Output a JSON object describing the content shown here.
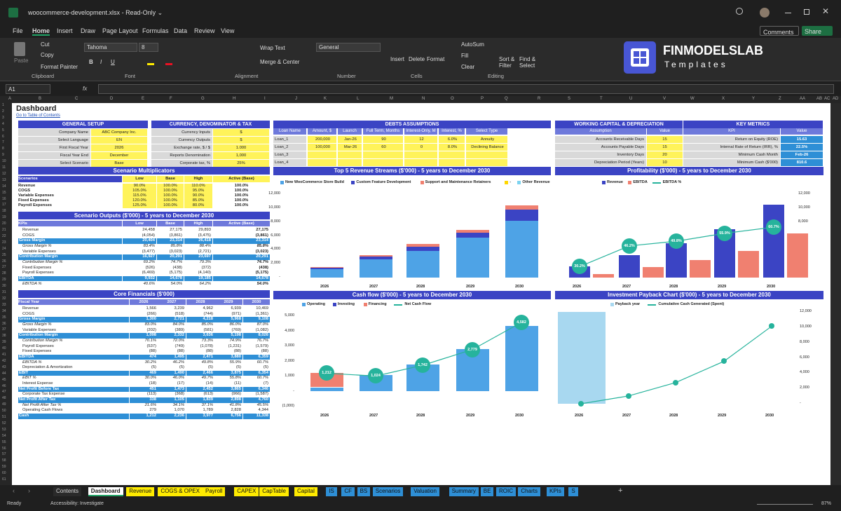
{
  "window": {
    "file": "woocommerce-development.xlsx",
    "mode": "Read-Only",
    "comments": "Comments",
    "share": "Share"
  },
  "menu": [
    "File",
    "Home",
    "Insert",
    "Draw",
    "Page Layout",
    "Formulas",
    "Data",
    "Review",
    "View"
  ],
  "ribbon": {
    "paste": "Paste",
    "cut": "Cut",
    "copy": "Copy",
    "format_painter": "Format Painter",
    "clipboard": "Clipboard",
    "font_name": "Tahoma",
    "font_size": "8",
    "font": "Font",
    "wrap": "Wrap Text",
    "merge": "Merge & Center",
    "alignment": "Alignment",
    "number_format": "General",
    "number": "Number",
    "insert": "Insert",
    "delete": "Delete",
    "format": "Format",
    "cells": "Cells",
    "autosum": "AutoSum",
    "fill": "Fill",
    "clear": "Clear",
    "sort": "Sort &",
    "filter": "Filter",
    "find": "Find &",
    "select": "Select",
    "editing": "Editing",
    "brand": "FINMODELSLAB",
    "brand2": "Templates"
  },
  "formula": {
    "cell": "A1",
    "fx": "fx"
  },
  "columns": [
    "A",
    "B",
    "C",
    "D",
    "E",
    "F",
    "G",
    "H",
    "I",
    "J",
    "K",
    "L",
    "M",
    "N",
    "O",
    "P",
    "Q",
    "R",
    "S",
    "T",
    "U",
    "V",
    "W",
    "X",
    "Y",
    "Z",
    "AA",
    "AB",
    "AC",
    "AD"
  ],
  "sheet": {
    "title": "Dashboard",
    "toc": "Go to Table of Contents",
    "general": {
      "header": "GENERAL SETUP",
      "rows": [
        [
          "Company Name",
          "ABC Company Inc."
        ],
        [
          "Select Language",
          "EN"
        ],
        [
          "First Fiscal Year",
          "2026"
        ],
        [
          "Fiscal Year End",
          "December"
        ],
        [
          "Select Scenario",
          "Base"
        ]
      ]
    },
    "currency": {
      "header": "CURRENCY, DENOMINATOR & TAX",
      "rows": [
        [
          "Currency Inputs",
          "$"
        ],
        [
          "Currency Outputs",
          "$"
        ],
        [
          "Exchange rate, $ / $",
          "1.000"
        ],
        [
          "Reports Denomination",
          "1,000"
        ],
        [
          "Corporate tax, %",
          "25%"
        ]
      ]
    },
    "debts": {
      "header": "DEBTS ASSUMPTIONS",
      "cols": [
        "Loan Name",
        "Amount, $",
        "Launch",
        "Full Term, Months",
        "Interest-Only, M",
        "Interest, %",
        "Select Type"
      ],
      "rows": [
        [
          "Loan_1",
          "200,000",
          "Jan-26",
          "90",
          "12",
          "6.0%",
          "Annuity"
        ],
        [
          "Loan_2",
          "100,000",
          "Mar-26",
          "60",
          "0",
          "8.0%",
          "Declining Balance"
        ],
        [
          "Loan_3",
          "",
          "",
          "",
          "",
          "",
          ""
        ],
        [
          "Loan_4",
          "",
          "",
          "",
          "",
          "",
          ""
        ]
      ]
    },
    "wc": {
      "header": "WORKING CAPITAL & DEPRECIATION",
      "cols": [
        "Assumption",
        "Value"
      ],
      "rows": [
        [
          "Accounts Receivable Days",
          "15"
        ],
        [
          "Accounts Payable Days",
          "15"
        ],
        [
          "Inventory Days",
          "20"
        ],
        [
          "Depreciation Period (Years)",
          "10"
        ]
      ]
    },
    "kpi": {
      "header": "KEY METRICS",
      "cols": [
        "KPI",
        "Value"
      ],
      "rows": [
        [
          "Return on Equity (ROE)",
          "15.63"
        ],
        [
          "Internal Rate of Return (IRR), %",
          "22.5%"
        ],
        [
          "Minimum Cash Month",
          "Feb-26"
        ],
        [
          "Minimum Cash ($'000)",
          "810.6"
        ]
      ]
    },
    "multipliers": {
      "header": "Scenario Multiplicators",
      "cols": [
        "Scenarios",
        "Low",
        "Base",
        "High",
        "Active (Base)"
      ],
      "rows": [
        [
          "Revenue",
          "90.0%",
          "100.0%",
          "110.0%",
          "100.0%"
        ],
        [
          "COGS",
          "105.0%",
          "100.0%",
          "95.0%",
          "100.0%"
        ],
        [
          "Variable Expenses",
          "115.0%",
          "100.0%",
          "90.0%",
          "100.0%"
        ],
        [
          "Fixed Expenses",
          "120.0%",
          "100.0%",
          "85.0%",
          "100.0%"
        ],
        [
          "Payroll Expenses",
          "125.0%",
          "100.0%",
          "80.0%",
          "100.0%"
        ]
      ]
    },
    "outputs": {
      "header": "Scenario Outputs ($'000) - 5 years to December 2030",
      "cols": [
        "KPIs",
        "Low",
        "Base",
        "High",
        "Active (Base)"
      ],
      "rows": [
        [
          "Revenue",
          "24,458",
          "27,175",
          "29,893",
          "27,175",
          "n"
        ],
        [
          "COGS",
          "(4,054)",
          "(3,861)",
          "(3,475)",
          "(3,861)",
          "n"
        ],
        [
          "Gross Margin",
          "20,404",
          "23,314",
          "26,418",
          "23,314",
          "h"
        ],
        [
          "Gross Margin %",
          "83.4%",
          "85.8%",
          "88.4%",
          "85.8%",
          "i"
        ],
        [
          "Variable Expenses",
          "(3,477)",
          "(3,023)",
          "(2,721)",
          "(3,023)",
          "n"
        ],
        [
          "Contribution Margin",
          "16,927",
          "20,291",
          "23,697",
          "20,291",
          "h"
        ],
        [
          "Contribution Margin %",
          "69.2%",
          "74.7%",
          "79.3%",
          "74.7%",
          "i"
        ],
        [
          "Fixed Expenses",
          "(526)",
          "(438)",
          "(372)",
          "(438)",
          "n"
        ],
        [
          "Payroll Expenses",
          "(6,469)",
          "(5,175)",
          "(4,140)",
          "(5,175)",
          "n"
        ],
        [
          "EBITDA",
          "9,932",
          "14,678",
          "19,185",
          "14,678",
          "h"
        ],
        [
          "EBITDA %",
          "40.6%",
          "54.0%",
          "64.2%",
          "54.0%",
          "i"
        ]
      ]
    },
    "core": {
      "header": "Core Financials ($'000)",
      "cols": [
        "Fiscal Year",
        "2026",
        "2027",
        "2028",
        "2029",
        "2030"
      ],
      "rows": [
        [
          "Revenue",
          "1,566",
          "3,239",
          "4,962",
          "6,939",
          "10,469",
          "n"
        ],
        [
          "COGS",
          "(266)",
          "(518)",
          "(744)",
          "(971)",
          "(1,361)",
          "n"
        ],
        [
          "Gross Margin",
          "1,300",
          "2,721",
          "4,218",
          "5,968",
          "9,108",
          "h"
        ],
        [
          "Gross Margin %",
          "83.0%",
          "84.0%",
          "85.0%",
          "86.0%",
          "87.0%",
          "i"
        ],
        [
          "Variable Expenses",
          "(202)",
          "(389)",
          "(581)",
          "(769)",
          "(1,082)",
          "n"
        ],
        [
          "Contribution Margin",
          "1,098",
          "2,332",
          "3,636",
          "5,198",
          "8,026",
          "h"
        ],
        [
          "Contribution Margin %",
          "70.1%",
          "72.0%",
          "73.3%",
          "74.9%",
          "76.7%",
          "i"
        ],
        [
          "Payroll Expenses",
          "(537)",
          "(749)",
          "(1,078)",
          "(1,231)",
          "(1,579)",
          "n"
        ],
        [
          "Fixed Expenses",
          "(88)",
          "(88)",
          "(88)",
          "(88)",
          "(88)",
          "n"
        ],
        [
          "EBITDA",
          "474",
          "1,495",
          "2,471",
          "3,880",
          "6,359",
          "h"
        ],
        [
          "EBITDA %",
          "30.2%",
          "46.2%",
          "49.8%",
          "55.9%",
          "60.7%",
          "i"
        ],
        [
          "Depreciation & Amortization",
          "(5)",
          "(5)",
          "(5)",
          "(5)",
          "(5)",
          "n"
        ],
        [
          "EBIT",
          "469",
          "1,490",
          "2,466",
          "3,875",
          "6,354",
          "h"
        ],
        [
          "EBIT %",
          "30.0%",
          "46.0%",
          "49.7%",
          "55.8%",
          "60.7%",
          "i"
        ],
        [
          "Interest Expense",
          "(18)",
          "(17)",
          "(14)",
          "(11)",
          "(7)",
          "n"
        ],
        [
          "Net Profit Before Tax",
          "451",
          "1,473",
          "2,452",
          "3,865",
          "6,346",
          "h"
        ],
        [
          "Corporate Tax Expense",
          "(113)",
          "(368)",
          "(613)",
          "(966)",
          "(1,587)",
          "n"
        ],
        [
          "Net Profit After Tax",
          "338",
          "1,105",
          "1,839",
          "2,898",
          "4,760",
          "h"
        ],
        [
          "Net Profit After Tax %",
          "21.6%",
          "34.1%",
          "37.1%",
          "41.8%",
          "45.5%",
          "i"
        ],
        [
          "Operating Cash Flows",
          "279",
          "1,070",
          "1,789",
          "2,828",
          "4,344",
          "n"
        ],
        [
          "Cash",
          "1,212",
          "2,236",
          "3,977",
          "6,756",
          "11,338",
          "h"
        ]
      ]
    }
  },
  "chart_data": [
    {
      "type": "bar",
      "title": "Top 5 Revenue Streams ($'000) - 5 years to December 2030",
      "categories": [
        "2026",
        "2027",
        "2028",
        "2029",
        "2030"
      ],
      "ylim": [
        0,
        12000
      ],
      "yticks": [
        "-",
        "2,000",
        "4,000",
        "6,000",
        "8,000",
        "10,000",
        "12,000"
      ],
      "series": [
        {
          "name": "New WooCommerce Store Build",
          "color": "#4ea3e6",
          "values": [
            1200,
            2600,
            3800,
            5700,
            8200
          ]
        },
        {
          "name": "Custom Feature Development",
          "color": "#3b44c4",
          "values": [
            200,
            400,
            600,
            800,
            1600
          ]
        },
        {
          "name": "Support and Maintenance Retainers",
          "color": "#f08070",
          "values": [
            100,
            200,
            400,
            400,
            600
          ]
        },
        {
          "name": "-",
          "color": "#ffd700",
          "values": [
            0,
            0,
            0,
            0,
            0
          ]
        },
        {
          "name": "Other Revenue",
          "color": "#7dd3f0",
          "values": [
            0,
            0,
            0,
            0,
            0
          ]
        }
      ]
    },
    {
      "type": "bar",
      "title": "Profitability ($'000) - 5 years to December 2030",
      "categories": [
        "2026",
        "2027",
        "2028",
        "2029",
        "2030"
      ],
      "ylim": [
        0,
        12000
      ],
      "yticks": [
        "-",
        "2,000",
        "4,000",
        "6,000",
        "8,000",
        "10,000",
        "12,000"
      ],
      "series": [
        {
          "name": "Revenue",
          "color": "#3b44c4",
          "values": [
            1566,
            3239,
            4962,
            6939,
            10469
          ]
        },
        {
          "name": "EBITDA",
          "color": "#f08070",
          "values": [
            474,
            1495,
            2471,
            3880,
            6359
          ]
        },
        {
          "name": "EBITDA %",
          "color": "#26b39c",
          "values": [
            30.2,
            46.2,
            49.8,
            55.9,
            60.7
          ],
          "labels": [
            "30.2%",
            "46.2%",
            "49.8%",
            "55.9%",
            "60.7%"
          ]
        }
      ]
    },
    {
      "type": "bar",
      "title": "Cash flow ($'000) - 5 years to December 2030",
      "categories": [
        "2026",
        "2027",
        "2028",
        "2029",
        "2030"
      ],
      "ylim": [
        -1000,
        5000
      ],
      "yticks": [
        "(1,000)",
        "-",
        "1,000",
        "2,000",
        "3,000",
        "4,000",
        "5,000"
      ],
      "series": [
        {
          "name": "Operating",
          "color": "#4ea3e6",
          "values": [
            279,
            1070,
            1789,
            2828,
            4344
          ]
        },
        {
          "name": "Investing",
          "color": "#3b44c4",
          "values": [
            -10,
            0,
            0,
            0,
            0
          ]
        },
        {
          "name": "Financing",
          "color": "#f08070",
          "values": [
            950,
            0,
            0,
            0,
            0
          ]
        },
        {
          "name": "Net Cash Flow",
          "color": "#26b39c",
          "values": [
            1212,
            1024,
            1742,
            2779,
            4582
          ],
          "labels": [
            "1,212",
            "1,024",
            "1,742",
            "2,779",
            "4,582"
          ]
        }
      ]
    },
    {
      "type": "line",
      "title": "Investment Payback Chart ($'000) - 5 years to December 2030",
      "categories": [
        "2026",
        "2027",
        "2028",
        "2029",
        "2030"
      ],
      "ylim": [
        0,
        12000
      ],
      "yticks": [
        "-",
        "2,000",
        "4,000",
        "6,000",
        "8,000",
        "10,000",
        "12,000"
      ],
      "series": [
        {
          "name": "Payback year",
          "color": "#a8d8f0",
          "values": [
            12000,
            0,
            0,
            0,
            0
          ]
        },
        {
          "name": "Cumulative Cash Generated (Spent)",
          "color": "#26b39c",
          "values": [
            0,
            1024,
            2766,
            5545,
            10127
          ]
        }
      ]
    }
  ],
  "tabs": [
    {
      "label": "Contents",
      "color": "#2a2a2a",
      "fg": "#ddd"
    },
    {
      "label": "Dashboard",
      "color": "#ffffff",
      "fg": "#111"
    },
    {
      "label": "Revenue",
      "color": "#ffeb00",
      "fg": "#111"
    },
    {
      "label": "COGS & OPEX",
      "color": "#ffeb00",
      "fg": "#111"
    },
    {
      "label": "Payroll",
      "color": "#ffeb00",
      "fg": "#111"
    },
    {
      "label": "CAPEX",
      "color": "#ffeb00",
      "fg": "#111"
    },
    {
      "label": "CapTable",
      "color": "#ffeb00",
      "fg": "#111"
    },
    {
      "label": "Capital",
      "color": "#ffeb00",
      "fg": "#111"
    },
    {
      "label": "IS",
      "color": "#2e8fd6",
      "fg": "#111"
    },
    {
      "label": "CF",
      "color": "#2e8fd6",
      "fg": "#111"
    },
    {
      "label": "BS",
      "color": "#2e8fd6",
      "fg": "#111"
    },
    {
      "label": "Scenarios",
      "color": "#2e8fd6",
      "fg": "#111"
    },
    {
      "label": "Valuation",
      "color": "#2e8fd6",
      "fg": "#111"
    },
    {
      "label": "Summary",
      "color": "#2e8fd6",
      "fg": "#111"
    },
    {
      "label": "BE",
      "color": "#2e8fd6",
      "fg": "#111"
    },
    {
      "label": "ROIC",
      "color": "#2e8fd6",
      "fg": "#111"
    },
    {
      "label": "Charts",
      "color": "#2e8fd6",
      "fg": "#111"
    },
    {
      "label": "KPIs",
      "color": "#2e8fd6",
      "fg": "#111"
    },
    {
      "label": "S",
      "color": "#2e8fd6",
      "fg": "#111"
    }
  ],
  "status": {
    "ready": "Ready",
    "accessibility": "Accessibility: Investigate",
    "zoom": "87%"
  }
}
